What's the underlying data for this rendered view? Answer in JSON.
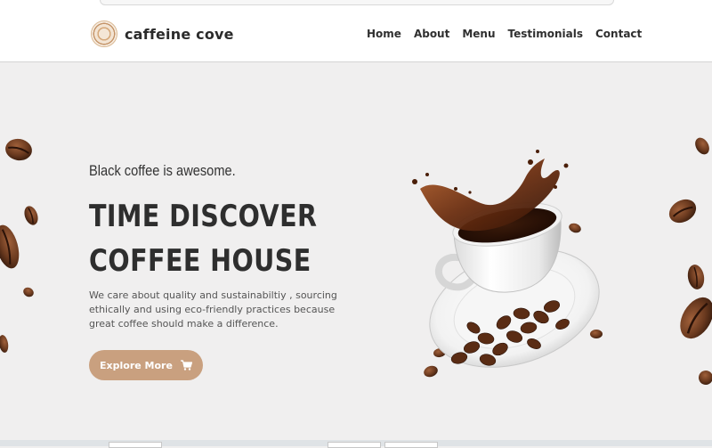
{
  "brand": {
    "name": "caffeine cove",
    "logo_icon": "coffee-swirl-logo",
    "accent": "#c9a07f"
  },
  "nav": {
    "items": [
      "Home",
      "About",
      "Menu",
      "Testimonials",
      "Contact"
    ]
  },
  "hero": {
    "tagline": "Black coffee is awesome.",
    "title_line1": "TIME DISCOVER",
    "title_line2": "COFFEE HOUSE",
    "description": "We care about quality and sustainabiltiy , sourcing ethically and using eco-friendly practices because great coffee should make a difference.",
    "cta_label": "Explore More",
    "cta_icon": "shopping-cart-icon"
  },
  "colors": {
    "background": "#f0efef",
    "header": "#ffffff",
    "text_dark": "#2e2e2e"
  }
}
